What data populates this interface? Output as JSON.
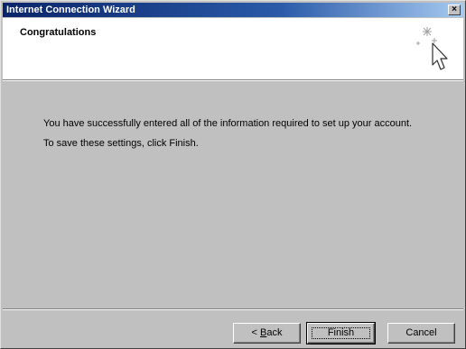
{
  "window": {
    "title": "Internet Connection Wizard",
    "close_label": "×"
  },
  "header": {
    "title": "Congratulations",
    "icon": "wizard-wand-cursor-icon"
  },
  "content": {
    "line1": "You have successfully entered all of the information required to set up your account.",
    "line2": "To save these settings, click Finish."
  },
  "buttons": {
    "back_mnemonic": "B",
    "back_prefix": "< ",
    "back_suffix": "ack",
    "finish_label": "Finish",
    "cancel_label": "Cancel"
  },
  "colors": {
    "title_bar_start": "#0a246a",
    "title_bar_end": "#a6caf0",
    "face": "#c0c0c0",
    "header_background": "#ffffff"
  }
}
